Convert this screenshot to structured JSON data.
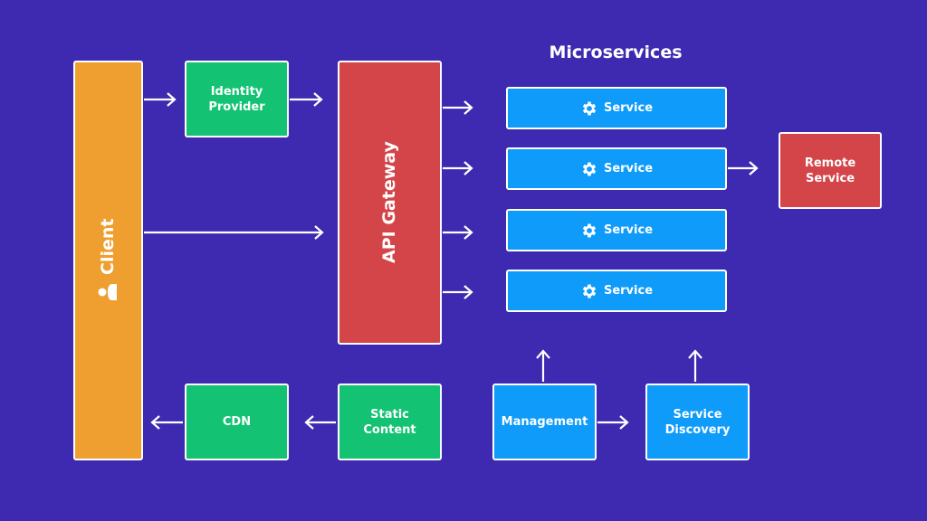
{
  "colors": {
    "background": "#3D2AB0",
    "client": "#EF9F30",
    "green": "#13C273",
    "red": "#D34549",
    "blue": "#0E9BF9"
  },
  "client": {
    "label": "Client",
    "icon": "user-icon"
  },
  "identity_provider": {
    "line1": "Identity",
    "line2": "Provider"
  },
  "api_gateway": {
    "label": "API Gateway"
  },
  "microservices": {
    "title": "Microservices",
    "services": [
      {
        "label": "Service",
        "icon": "gear-icon"
      },
      {
        "label": "Service",
        "icon": "gear-icon"
      },
      {
        "label": "Service",
        "icon": "gear-icon"
      },
      {
        "label": "Service",
        "icon": "gear-icon"
      }
    ]
  },
  "remote_service": {
    "line1": "Remote",
    "line2": "Service"
  },
  "cdn": {
    "label": "CDN"
  },
  "static_content": {
    "line1": "Static",
    "line2": "Content"
  },
  "management": {
    "label": "Management"
  },
  "service_discovery": {
    "line1": "Service",
    "line2": "Discovery"
  }
}
